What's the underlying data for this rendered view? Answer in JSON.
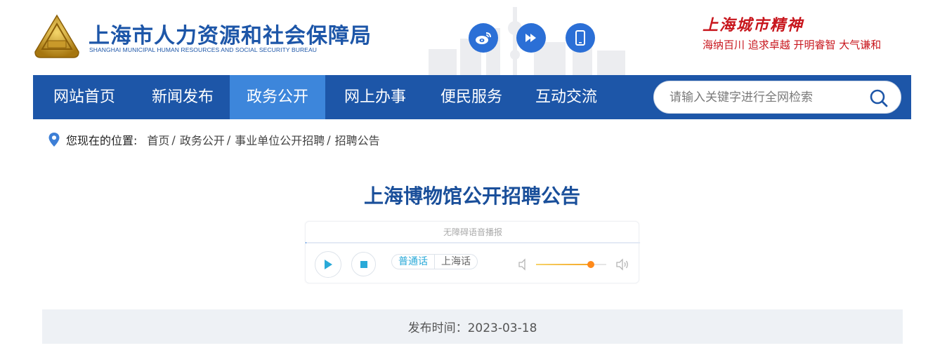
{
  "header": {
    "title": "上海市人力资源和社会保障局",
    "subtitle": "SHANGHAI MUNICIPAL HUMAN RESOURCES AND SOCIAL SECURITY BUREAU",
    "social_icons": [
      "weibo-icon",
      "fast-forward-icon",
      "mobile-phone-icon"
    ],
    "slogan_title": "上海城市精神",
    "slogan_text": "海纳百川  追求卓越  开明睿智  大气谦和"
  },
  "nav": {
    "items": [
      {
        "label": "网站首页"
      },
      {
        "label": "新闻发布"
      },
      {
        "label": "政务公开"
      },
      {
        "label": "网上办事"
      },
      {
        "label": "便民服务"
      },
      {
        "label": "互动交流"
      }
    ],
    "active": "政务公开",
    "search_placeholder": "请输入关键字进行全网检索"
  },
  "breadcrumb": {
    "label": "您现在的位置:",
    "items": [
      "首页",
      "政务公开",
      "事业单位公开招聘",
      "招聘公告"
    ],
    "separator": "/"
  },
  "article": {
    "title": "上海博物馆公开招聘公告",
    "publish_label": "发布时间:",
    "publish_date": "2023-03-18",
    "publish_text": "发布时间：2023-03-18"
  },
  "player": {
    "label": "无障碍语音播报",
    "progress": 0.002,
    "languages": [
      "普通话",
      "上海话"
    ],
    "active_language": "普通话",
    "volume": 0.78
  },
  "colors": {
    "brand_blue": "#1d56a8",
    "nav_active": "#3d86db",
    "slogan_red": "#c8161d",
    "title_blue": "#1a4f9a"
  }
}
